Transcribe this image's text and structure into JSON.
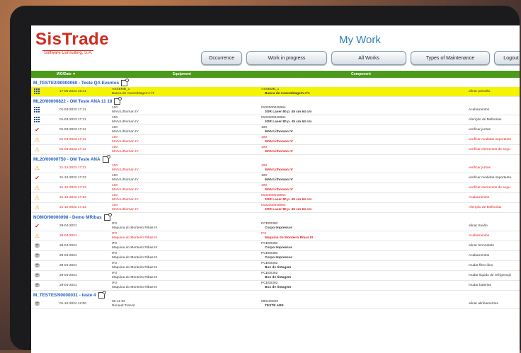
{
  "app": {
    "logo_text": "SisTrade",
    "logo_sub": "Software Consulting, S.A.",
    "title": "My Work"
  },
  "toolbar": {
    "buttons": [
      {
        "label": "Occurrence"
      },
      {
        "label": "Work in progress"
      },
      {
        "label": "All Works"
      },
      {
        "label": "Types of Maintenance"
      },
      {
        "label": "Logout"
      }
    ]
  },
  "table": {
    "headers": {
      "date": "WO/Date ▼",
      "equipment": "Equipment",
      "component": "Component"
    }
  },
  "groups": [
    {
      "title": "M_TESTE2/90000060 - Teste QA Eventos",
      "rows": [
        {
          "icon": "grid",
          "date": "17-05-2024 16:41",
          "equip_code": "ASSEMB_1",
          "equip_name": "Banca de Assemblagem nº1",
          "comp_code": "ASSEMB_1",
          "comp_name": "Banca de Assemblagem nº1",
          "op": "afinar pressão",
          "style": "hl"
        }
      ]
    },
    {
      "title": "ML20/00000822 - OM Teste ANA 11 18",
      "rows": [
        {
          "icon": "grid",
          "date": "01-03-2023 17:11",
          "equip_code": "100",
          "equip_name": "MAN Lithoman IV",
          "comp_code": "0102000045064",
          "comp_name": "3OR Laser 80 p. 45 cm 64 cm",
          "op": "Acabamentos",
          "style": ""
        },
        {
          "icon": "grid",
          "date": "01-03-2023 17:11",
          "equip_code": "100",
          "equip_name": "MAN Lithoman IV",
          "comp_code": "0102000045064",
          "comp_name": "3OR Laser 80 p. 45 cm 64 cm",
          "op": "Aferição de Melhorias",
          "style": ""
        },
        {
          "icon": "check",
          "date": "01-03-2023 17:11",
          "equip_code": "100",
          "equip_name": "MAN Lithoman IV",
          "comp_code": "100",
          "comp_name": "MAN Lithoman IV",
          "op": "verificar juntas",
          "style": ""
        },
        {
          "icon": "warn",
          "date": "01-03-2023 17:11",
          "equip_code": "100",
          "equip_name": "MAN Lithoman IV",
          "comp_code": "100",
          "comp_name": "MAN Lithoman IV",
          "op": "verificar medidas importante",
          "style": "red"
        },
        {
          "icon": "warn",
          "date": "01-03-2023 17:11",
          "equip_code": "100",
          "equip_name": "MAN Lithoman IV",
          "comp_code": "100",
          "comp_name": "MAN Lithoman IV",
          "op": "verificar elementos de segu",
          "style": "red"
        }
      ]
    },
    {
      "title": "ML20/00000750 - OM Teste ANA",
      "rows": [
        {
          "icon": "warn",
          "date": "21-12-2022 17:22",
          "equip_code": "100",
          "equip_name": "MAN Lithoman IV",
          "comp_code": "100",
          "comp_name": "MAN Lithoman IV",
          "op": "verificar juntas",
          "style": "red"
        },
        {
          "icon": "check",
          "date": "21-12-2022 17:22",
          "equip_code": "100",
          "equip_name": "MAN Lithoman IV",
          "comp_code": "100",
          "comp_name": "MAN Lithoman IV",
          "op": "verificar medidas importante",
          "style": ""
        },
        {
          "icon": "warn",
          "date": "21-12-2022 17:22",
          "equip_code": "100",
          "equip_name": "MAN Lithoman IV",
          "comp_code": "100",
          "comp_name": "MAN Lithoman IV",
          "op": "verificar elementos de segu",
          "style": "red"
        },
        {
          "icon": "warn",
          "date": "21-12-2022 17:22",
          "equip_code": "100",
          "equip_name": "MAN Lithoman IV",
          "comp_code": "0102000045064",
          "comp_name": "3OR Laser 80 p. 45 cm 64 cm",
          "op": "Acabamentos",
          "style": "red"
        },
        {
          "icon": "warn",
          "date": "21-12-2022 17:22",
          "equip_code": "100",
          "equip_name": "MAN Lithoman IV",
          "comp_code": "0102000045064",
          "comp_name": "3OR Laser 80 p. 45 cm 64 cm",
          "op": "Aferição de Melhorias",
          "style": "red"
        }
      ]
    },
    {
      "title": "NOMO/90000098 - Demo MRibas",
      "rows": [
        {
          "icon": "check",
          "date": "29-04-2021",
          "equip_code": "IF3",
          "equip_name": "Maquina do Monteiro Ribas III",
          "comp_code": "PCE00390",
          "comp_name": "Corpo Impressor",
          "op": "afinar travão",
          "style": ""
        },
        {
          "icon": "warn",
          "date": "29-04-2021",
          "equip_code": "IF3",
          "equip_name": "Maquina do Monteiro Ribas III",
          "comp_code": "IF3",
          "comp_name": "Maquina do Monteiro Ribas III",
          "op": "Acabamentos",
          "style": "red"
        },
        {
          "icon": "lock",
          "date": "29-04-2021",
          "equip_code": "IF3",
          "equip_name": "Maquina do Monteiro Ribas III",
          "comp_code": "PCE00390",
          "comp_name": "Corpo Impressor",
          "op": "afinar termostato",
          "style": ""
        },
        {
          "icon": "lock",
          "date": "29-04-2021",
          "equip_code": "IF3",
          "equip_name": "Maquina do Monteiro Ribas III",
          "comp_code": "PCE00390",
          "comp_name": "Corpo Impressor",
          "op": "Acabamentos",
          "style": ""
        },
        {
          "icon": "lock",
          "date": "29-04-2021",
          "equip_code": "IF3",
          "equip_name": "Maquina do Monteiro Ribas III",
          "comp_code": "PCE00392",
          "comp_name": "Box de tintagem",
          "op": "mudar filtro óleo",
          "style": ""
        },
        {
          "icon": "lock",
          "date": "29-04-2021",
          "equip_code": "IF3",
          "equip_name": "Maquina do Monteiro Ribas III",
          "comp_code": "PCE00392",
          "comp_name": "Box de tintagem",
          "op": "mudar liquido de refrigeraçã",
          "style": ""
        },
        {
          "icon": "lock",
          "date": "29-04-2021",
          "equip_code": "IF3",
          "equip_name": "Maquina do Monteiro Ribas III",
          "comp_code": "PCE00392",
          "comp_name": "Box de tintagem",
          "op": "mudar baterias",
          "style": ""
        }
      ]
    },
    {
      "title": "M_TESTES/90000031 - teste 4",
      "rows": [
        {
          "icon": "lock",
          "date": "01-12-2024 12:00",
          "equip_code": "00-11-03",
          "equip_name": "Renault Transit",
          "comp_code": "090100020",
          "comp_name": "TESTE ARE",
          "op": "afinar alinhamentos",
          "style": ""
        }
      ]
    }
  ]
}
